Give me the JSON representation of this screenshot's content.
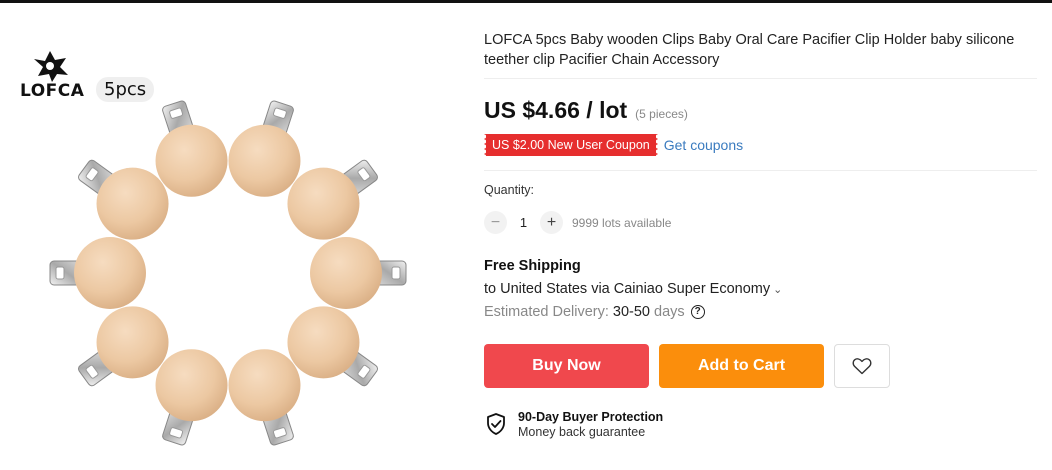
{
  "gallery": {
    "brand_name": "LOFCA",
    "quantity_tag": "5pcs"
  },
  "product": {
    "title": "LOFCA 5pcs Baby wooden Clips Baby Oral Care Pacifier Clip Holder baby silicone teether clip Pacifier Chain Accessory",
    "price": "US $4.66 / lot",
    "pieces": "(5 pieces)",
    "coupon": "US $2.00 New User Coupon",
    "get_coupons": "Get coupons"
  },
  "quantity": {
    "label": "Quantity:",
    "minus": "−",
    "value": "1",
    "plus": "+",
    "available": "9999 lots available"
  },
  "shipping": {
    "title": "Free Shipping",
    "destination": "to United States via Cainiao Super Economy",
    "chevron": "⌄",
    "est_label": "Estimated Delivery:",
    "est_value": "30-50",
    "est_unit": "days",
    "help_icon": "?"
  },
  "actions": {
    "buy_now": "Buy Now",
    "add_to_cart": "Add to Cart",
    "wishlist_icon": "heart-icon"
  },
  "protection": {
    "title": "90-Day Buyer Protection",
    "subtitle": "Money back guarantee",
    "icon": "shield-check-icon"
  },
  "colors": {
    "buy_now": "#f0484d",
    "add_to_cart": "#fb8e0c",
    "coupon": "#e62e2e",
    "link": "#3a7bbf"
  }
}
